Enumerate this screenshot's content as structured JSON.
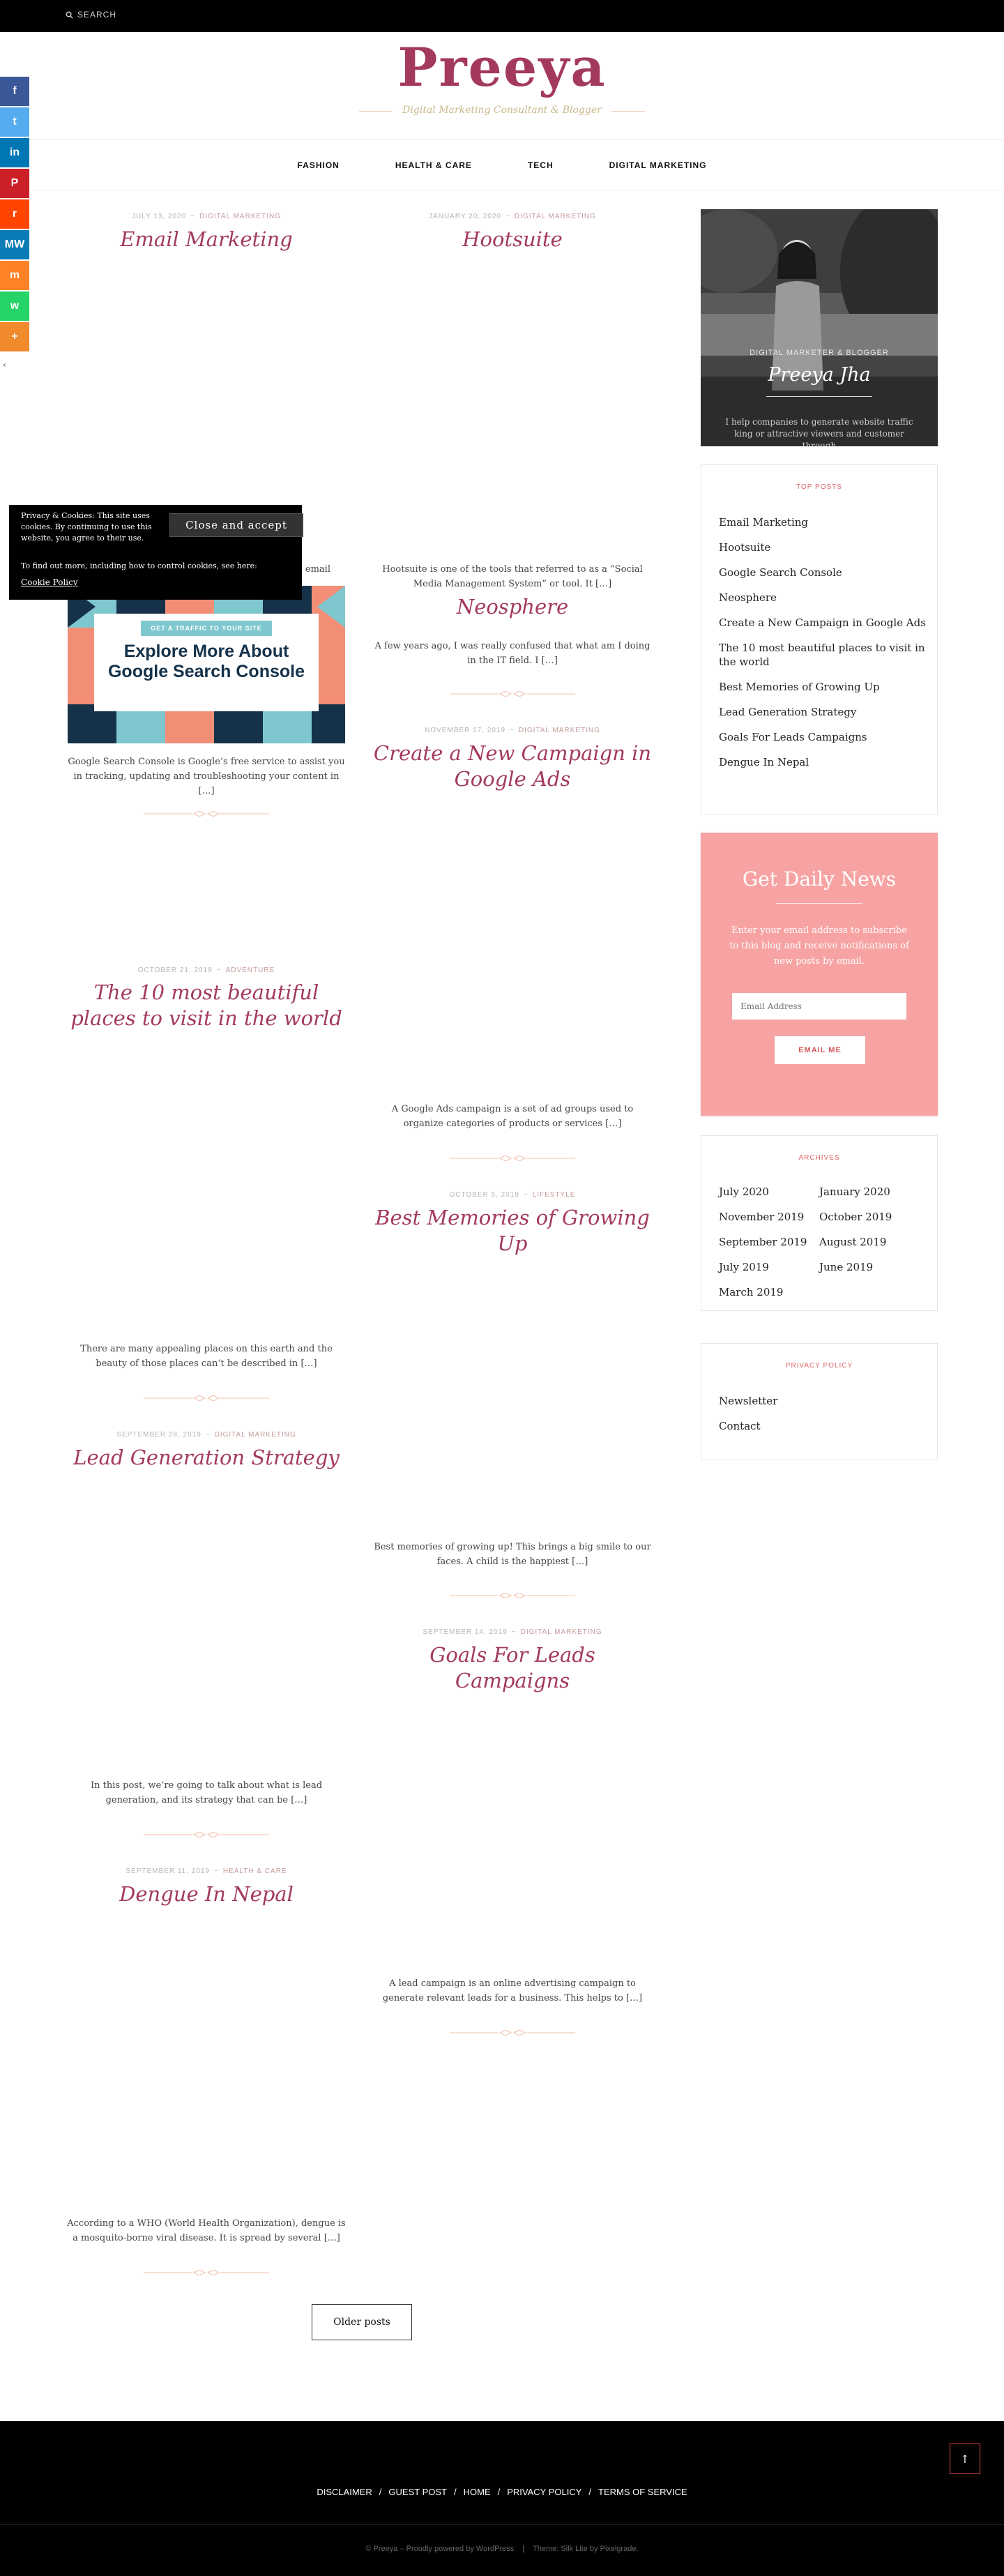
{
  "topbar": {
    "search_label": "SEARCH"
  },
  "site": {
    "title": "Preeya",
    "tagline": "Digital Marketing Consultant & Blogger"
  },
  "nav": [
    "FASHION",
    "HEALTH & CARE",
    "TECH",
    "DIGITAL MARKETING"
  ],
  "share": [
    {
      "name": "facebook",
      "glyph": "f",
      "color": "#3b5998"
    },
    {
      "name": "twitter",
      "glyph": "t",
      "color": "#55acee"
    },
    {
      "name": "linkedin",
      "glyph": "in",
      "color": "#0077b5"
    },
    {
      "name": "pinterest",
      "glyph": "P",
      "color": "#cb2027"
    },
    {
      "name": "reddit",
      "glyph": "r",
      "color": "#ff4500"
    },
    {
      "name": "mewe",
      "glyph": "MW",
      "color": "#0b7bb5"
    },
    {
      "name": "mix",
      "glyph": "m",
      "color": "#ff8226"
    },
    {
      "name": "whatsapp",
      "glyph": "w",
      "color": "#25d366"
    },
    {
      "name": "more",
      "glyph": "+",
      "color": "#f1892d"
    }
  ],
  "posts": {
    "email_marketing": {
      "date": "JULY 13, 2020",
      "category": "DIGITAL MARKETING",
      "title": "Email Marketing",
      "excerpt_tail": "email"
    },
    "hootsuite": {
      "date": "JANUARY 20, 2020",
      "category": "DIGITAL MARKETING",
      "title": "Hootsuite",
      "excerpt": "Hootsuite is one of the tools that referred to as a “Social Media Management System” or tool. It […]"
    },
    "gsc": {
      "excerpt": "Google Search Console is Google’s free service to assist you in tracking, updating and troubleshooting your content in […]",
      "image_tag": "GET A TRAFFIC TO YOUR SITE",
      "image_title": "Explore More About Google Search Console"
    },
    "neosphere": {
      "title": "Neosphere",
      "excerpt": "A few years ago, I was really confused that what am I doing in the IT field. I […]"
    },
    "campaign": {
      "date": "NOVEMBER 17, 2019",
      "category": "DIGITAL MARKETING",
      "title": "Create a New Campaign in Google Ads",
      "excerpt": "A Google Ads campaign is a set of ad groups used to organize categories of products or services […]"
    },
    "places": {
      "date": "OCTOBER 21, 2019",
      "category": "ADVENTURE",
      "title": "The 10 most beautiful places to visit in the world",
      "excerpt": "There are many appealing places on this earth and the beauty of those places can’t be described in […]"
    },
    "memories": {
      "date": "OCTOBER 5, 2019",
      "category": "LIFESTYLE",
      "title": "Best Memories of Growing Up",
      "excerpt": "Best memories of growing up! This brings a big smile to our faces. A child is the happiest […]"
    },
    "leadgen": {
      "date": "SEPTEMBER 28, 2019",
      "category": "DIGITAL MARKETING",
      "title": "Lead Generation Strategy",
      "excerpt": "In this post, we’re going to talk about what is lead generation, and its strategy that can be […]"
    },
    "goals": {
      "date": "SEPTEMBER 14, 2019",
      "category": "DIGITAL MARKETING",
      "title": "Goals For Leads Campaigns",
      "excerpt": "A lead campaign is an online advertising campaign to generate relevant leads for a business. This helps to […]"
    },
    "dengue": {
      "date": "SEPTEMBER 11, 2019",
      "category": "HEALTH & CARE",
      "title": "Dengue In Nepal",
      "excerpt": "According to a WHO (World Health Organization), dengue is a mosquito-borne viral disease. It is spread by several […]"
    }
  },
  "older_posts": "Older posts",
  "profile": {
    "role": "DIGITAL MARKETER & BLOGGER",
    "name": "Preeya Jha",
    "bio": "I help companies to generate website traffic king or attractive viewers and customer through"
  },
  "top_posts": {
    "title": "TOP POSTS",
    "items": [
      "Email Marketing",
      "Hootsuite",
      "Google Search Console",
      "Neosphere",
      "Create a New Campaign in Google Ads",
      "The 10 most beautiful places to visit in the world",
      "Best Memories of Growing Up",
      "Lead Generation Strategy",
      "Goals For Leads Campaigns",
      "Dengue In Nepal"
    ]
  },
  "newsletter": {
    "title": "Get Daily News",
    "description": "Enter your email address to subscribe to this blog and receive notifications of new posts by email.",
    "placeholder": "Email Address",
    "button": "EMAIL ME"
  },
  "archives": {
    "title": "ARCHIVES",
    "left": [
      "July 2020",
      "November 2019",
      "September 2019",
      "July 2019",
      "March 2019"
    ],
    "right": [
      "January 2020",
      "October 2019",
      "August 2019",
      "June 2019"
    ]
  },
  "privacy": {
    "title": "PRIVACY POLICY",
    "items": [
      "Newsletter",
      "Contact"
    ]
  },
  "cookie": {
    "text": "Privacy & Cookies: This site uses cookies. By continuing to use this website, you agree to their use.",
    "more": "To find out more, including how to control cookies, see here:",
    "link": "Cookie Policy",
    "button": "Close and accept"
  },
  "footer": {
    "links": [
      "DISCLAIMER",
      "GUEST POST",
      "HOME",
      "PRIVACY POLICY",
      "TERMS OF SERVICE"
    ],
    "credits_left": "© Preeya – Proudly powered by WordPress",
    "credits_right": "Theme: Silk Lite by Pixelgrade."
  },
  "colors": {
    "accent": "#a33a5b",
    "newsletter_bg": "#f7a3a3",
    "gold": "#c8b88a"
  }
}
